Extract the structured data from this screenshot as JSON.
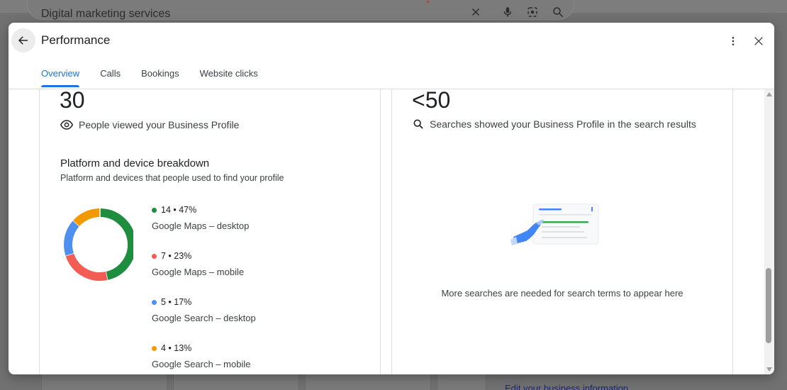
{
  "background": {
    "search_text": "Digital marketing services",
    "edit_link": "Edit your business information"
  },
  "dialog": {
    "title": "Performance",
    "tabs": [
      {
        "label": "Overview",
        "active": true
      },
      {
        "label": "Calls",
        "active": false
      },
      {
        "label": "Bookings",
        "active": false
      },
      {
        "label": "Website clicks",
        "active": false
      }
    ]
  },
  "left_card": {
    "views_value": "30",
    "views_label": "People viewed your Business Profile",
    "breakdown_title": "Platform and device breakdown",
    "breakdown_subtitle": "Platform and devices that people used to find your profile",
    "legend": [
      {
        "value": "14 • 47%",
        "label": "Google Maps – desktop",
        "color": "#1e8e3e"
      },
      {
        "value": "7 • 23%",
        "label": "Google Maps – mobile",
        "color": "#f25c54"
      },
      {
        "value": "5 • 17%",
        "label": "Google Search – desktop",
        "color": "#4f8ff0"
      },
      {
        "value": "4 • 13%",
        "label": "Google Search – mobile",
        "color": "#f29900"
      }
    ]
  },
  "right_card": {
    "searches_value": "<50",
    "searches_label": "Searches showed your Business Profile in the search results",
    "empty_message": "More searches are needed for search terms to appear here"
  },
  "chart_data": {
    "type": "pie",
    "categories": [
      "Google Maps – desktop",
      "Google Maps – mobile",
      "Google Search – desktop",
      "Google Search – mobile"
    ],
    "values": [
      14,
      7,
      5,
      4
    ],
    "percentages": [
      47,
      23,
      17,
      13
    ],
    "colors": [
      "#1e8e3e",
      "#f25c54",
      "#4f8ff0",
      "#f29900"
    ]
  }
}
